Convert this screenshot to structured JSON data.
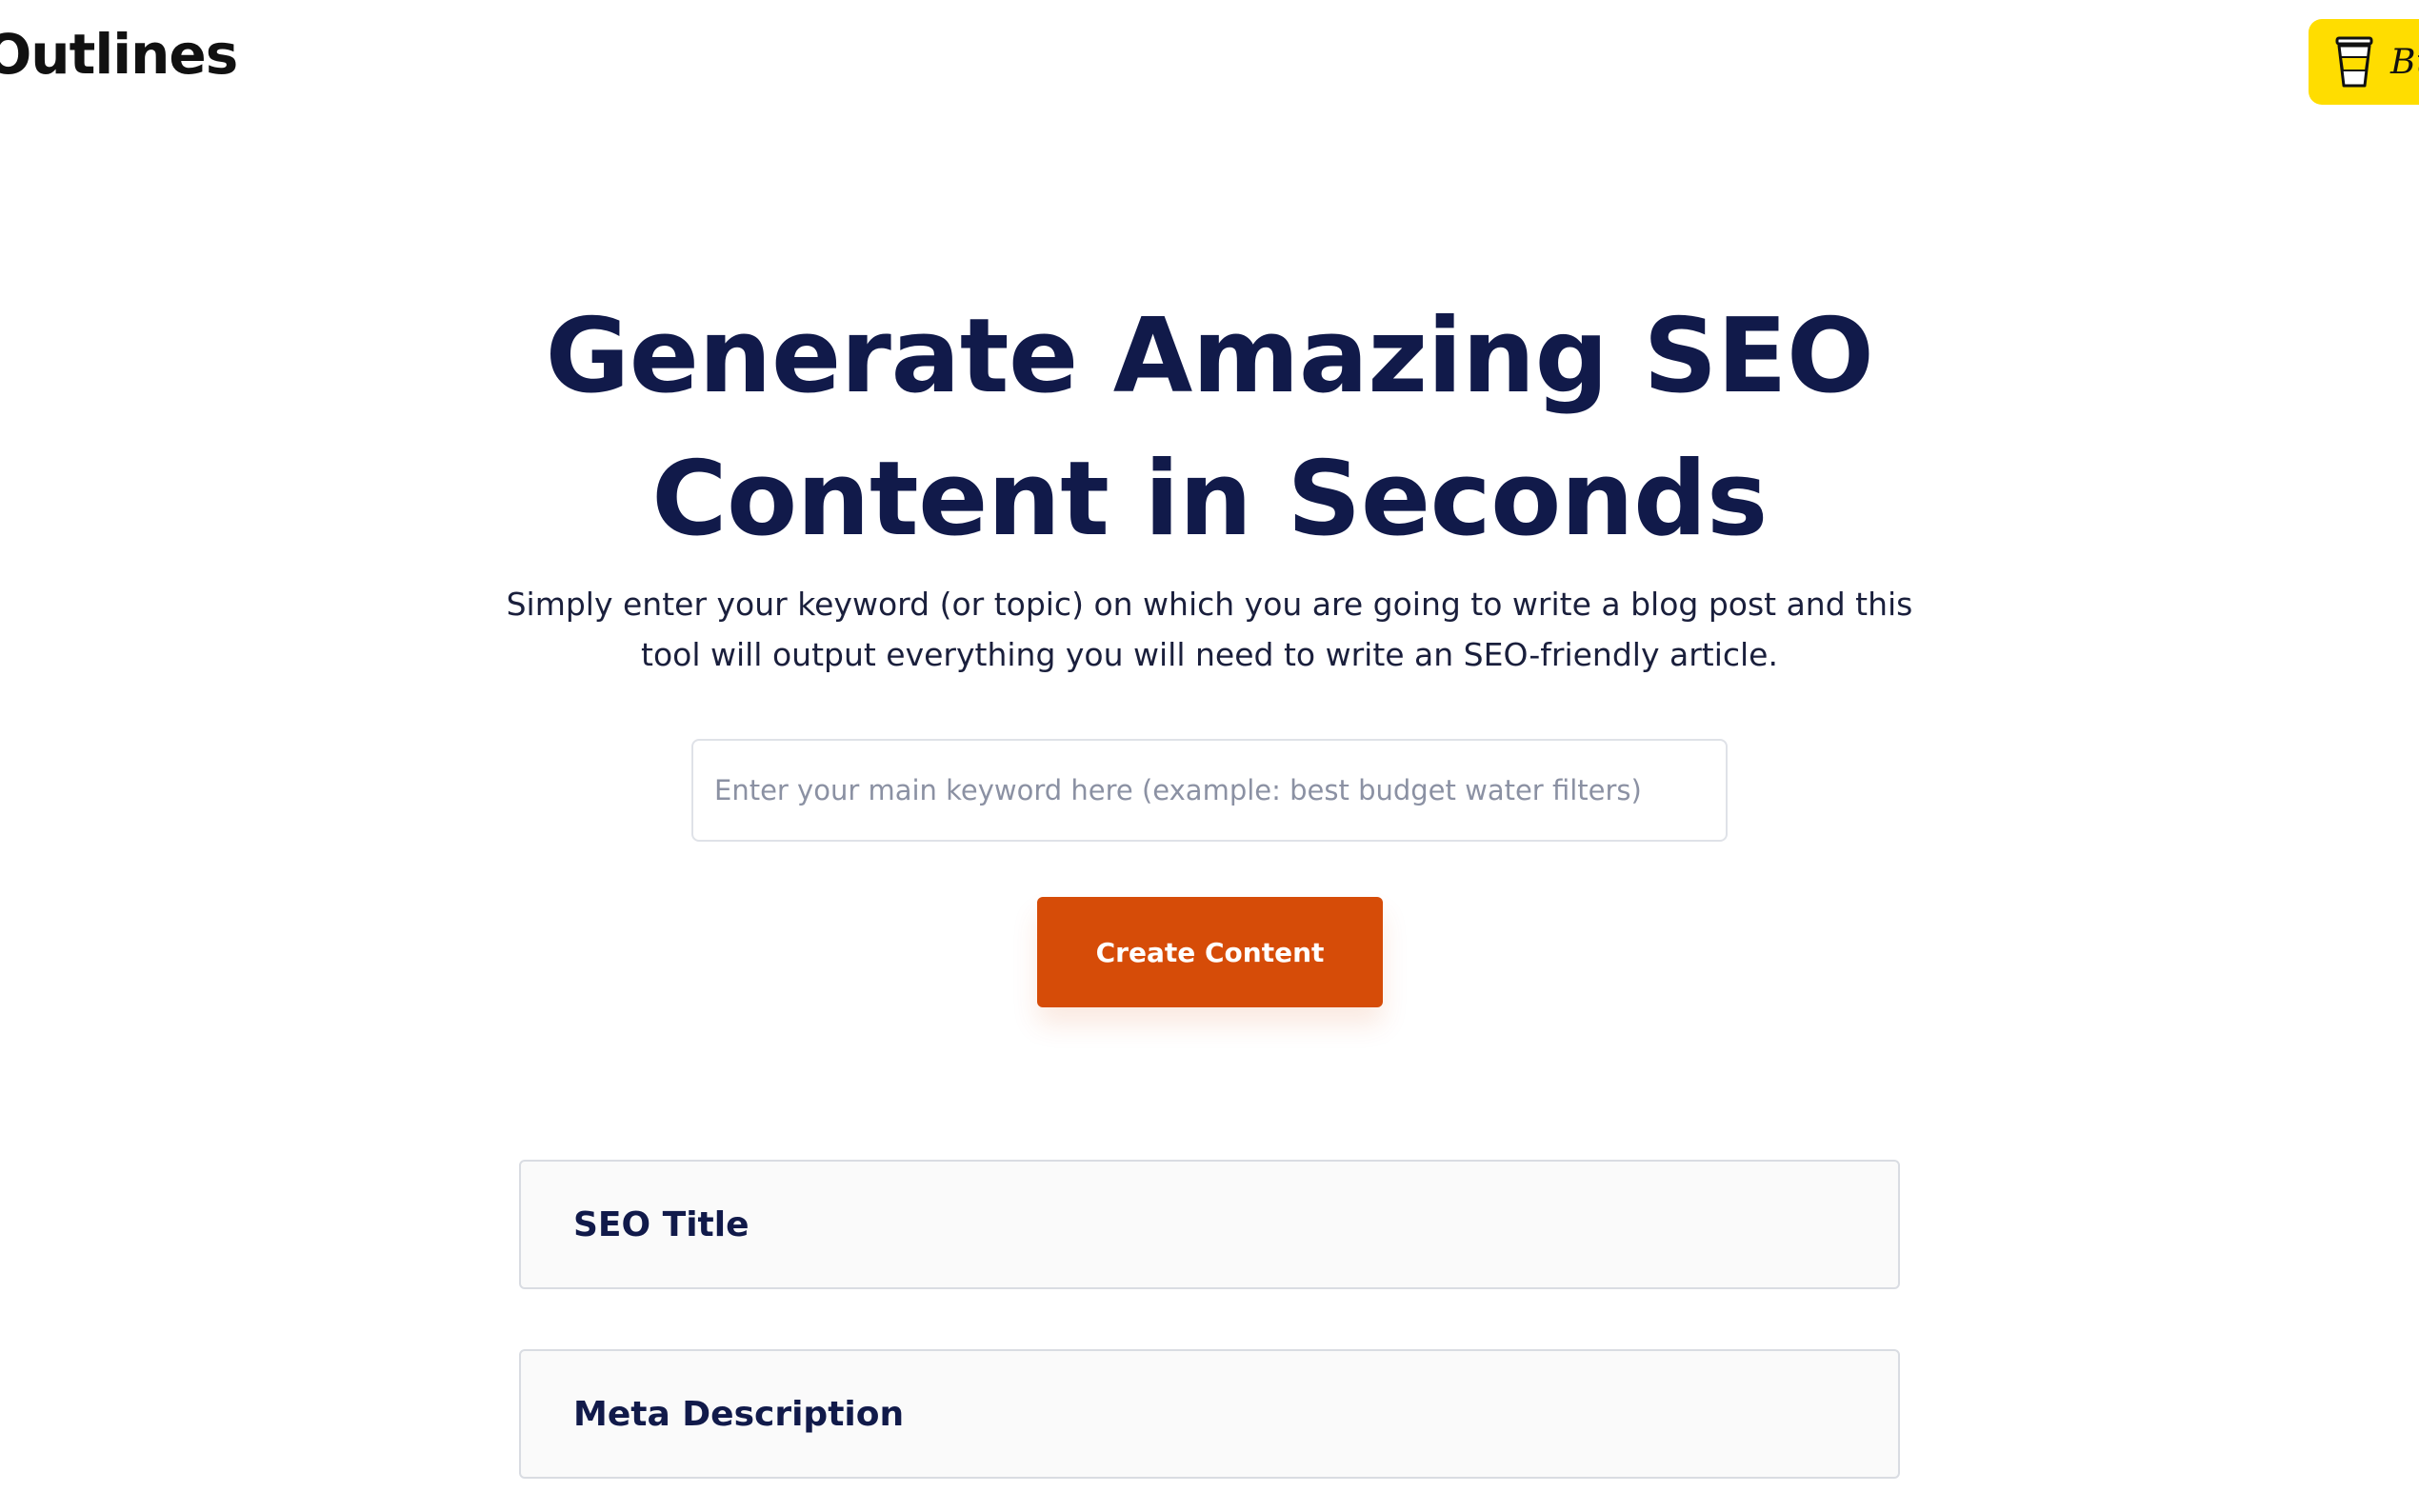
{
  "header": {
    "brand": "Outlines",
    "support_button_label": "Bu",
    "support_button_icon": "coffee-cup-icon",
    "support_button_color": "#ffdd00"
  },
  "hero": {
    "title": "Generate Amazing SEO Content in Seconds",
    "subtitle": "Simply enter your keyword (or topic) on which you are going to write a blog post and this tool will output everything you will need to write an SEO-friendly article."
  },
  "form": {
    "keyword_input": {
      "value": "",
      "placeholder": "Enter your main keyword here (example: best budget water filters)"
    },
    "submit_label": "Create Content",
    "submit_color": "#d64c08"
  },
  "results": {
    "sections": [
      {
        "title": "SEO Title"
      },
      {
        "title": "Meta Description"
      }
    ]
  },
  "colors": {
    "heading": "#111a4a",
    "panel_background": "#fafafa",
    "panel_border": "#d9dce2"
  }
}
